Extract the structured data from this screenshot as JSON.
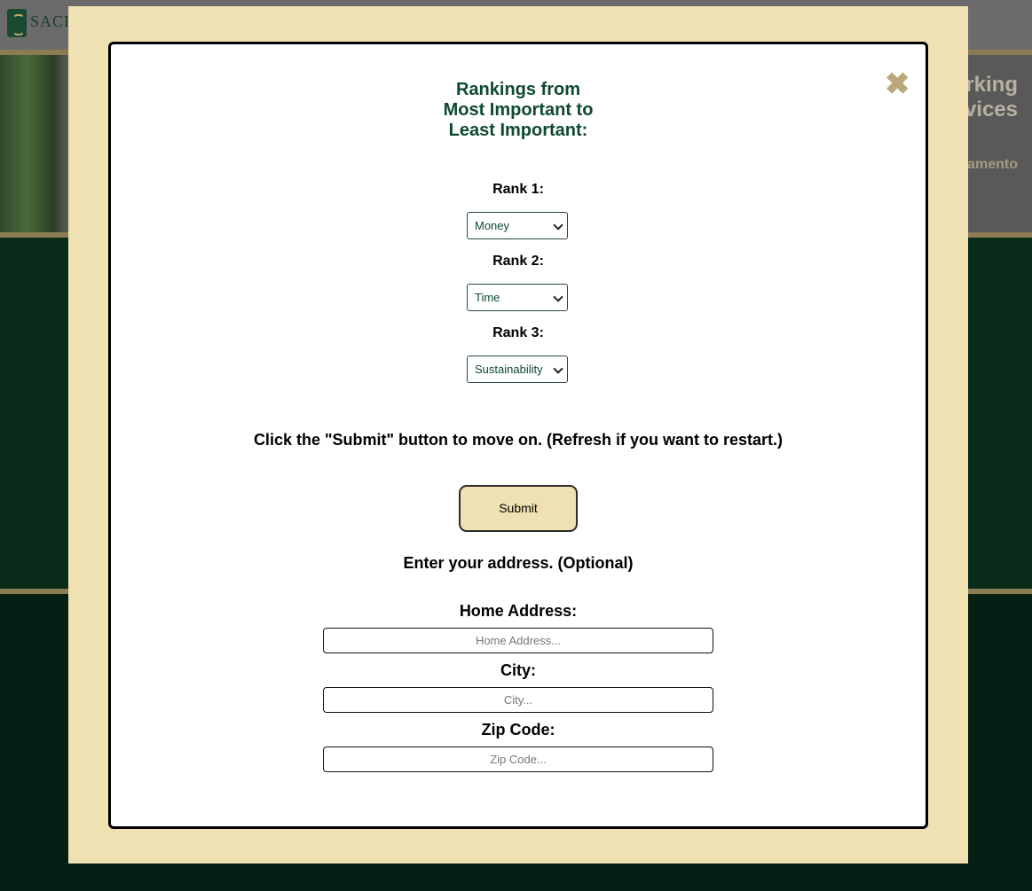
{
  "background": {
    "logo_text": "SACRA",
    "hero_line1": "rking",
    "hero_line2": "vices",
    "hero_line3": "amento"
  },
  "modal": {
    "title_lines": [
      "Rankings from",
      "Most Important to",
      "Least Important:"
    ],
    "close_icon": "close-x-icon",
    "ranks": [
      {
        "label": "Rank 1:",
        "selected": "Money"
      },
      {
        "label": "Rank 2:",
        "selected": "Time"
      },
      {
        "label": "Rank 3:",
        "selected": "Sustainability"
      }
    ],
    "instruction": "Click the \"Submit\" button to move on. (Refresh if you want to restart.)",
    "submit_label": "Submit",
    "address_title": "Enter your address. (Optional)",
    "fields": [
      {
        "label": "Home Address:",
        "placeholder": "Home Address..."
      },
      {
        "label": "City:",
        "placeholder": "City..."
      },
      {
        "label": "Zip Code:",
        "placeholder": "Zip Code..."
      }
    ]
  },
  "colors": {
    "accent_gold": "#f0e1b2",
    "title_green": "#0e4a2c",
    "close_gold": "#b9a87b"
  }
}
